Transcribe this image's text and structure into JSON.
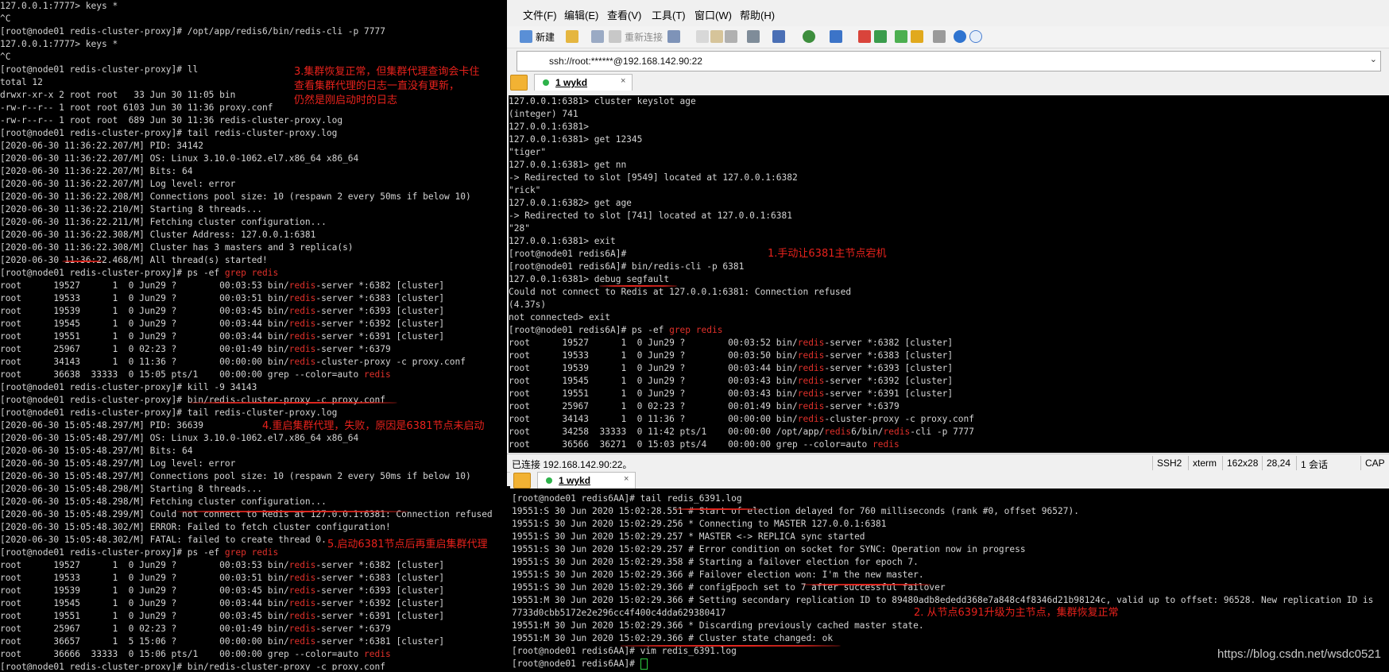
{
  "left_terminal": {
    "lines": [
      "127.0.0.1:7777> keys *",
      "^C",
      "[root@node01 redis-cluster-proxy]# /opt/app/redis6/bin/redis-cli -p 7777",
      "127.0.0.1:7777> keys *",
      "^C",
      "[root@node01 redis-cluster-proxy]# ll",
      "total 12",
      "drwxr-xr-x 2 root root   33 Jun 30 11:05 bin",
      "-rw-r--r-- 1 root root 6103 Jun 30 11:36 proxy.conf",
      "-rw-r--r-- 1 root root  689 Jun 30 11:36 redis-cluster-proxy.log",
      "[root@node01 redis-cluster-proxy]# tail redis-cluster-proxy.log",
      "[2020-06-30 11:36:22.207/M] PID: 34142",
      "[2020-06-30 11:36:22.207/M] OS: Linux 3.10.0-1062.el7.x86_64 x86_64",
      "[2020-06-30 11:36:22.207/M] Bits: 64",
      "[2020-06-30 11:36:22.207/M] Log level: error",
      "[2020-06-30 11:36:22.208/M] Connections pool size: 10 (respawn 2 every 50ms if below 10)",
      "[2020-06-30 11:36:22.210/M] Starting 8 threads...",
      "[2020-06-30 11:36:22.211/M] Fetching cluster configuration...",
      "[2020-06-30 11:36:22.308/M] Cluster Address: 127.0.0.1:6381",
      "[2020-06-30 11:36:22.308/M] Cluster has 3 masters and 3 replica(s)",
      "[2020-06-30 11:36:22.468/M] All thread(s) started!",
      "[root@node01 redis-cluster-proxy]# ps -ef |grep redis",
      "root      19527      1  0 Jun29 ?        00:03:53 bin/|redis|-server *:6382 [cluster]",
      "root      19533      1  0 Jun29 ?        00:03:51 bin/|redis|-server *:6383 [cluster]",
      "root      19539      1  0 Jun29 ?        00:03:45 bin/|redis|-server *:6393 [cluster]",
      "root      19545      1  0 Jun29 ?        00:03:44 bin/|redis|-server *:6392 [cluster]",
      "root      19551      1  0 Jun29 ?        00:03:44 bin/|redis|-server *:6391 [cluster]",
      "root      25967      1  0 02:23 ?        00:01:49 bin/|redis|-server *:6379",
      "root      34143      1  0 11:36 ?        00:00:00 bin/|redis|-cluster-proxy -c proxy.conf",
      "root      36638  33333  0 15:05 pts/1    00:00:00 grep --color=auto |redis|",
      "[root@node01 redis-cluster-proxy]# kill -9 34143",
      "[root@node01 redis-cluster-proxy]# bin/redis-cluster-proxy -c proxy.conf",
      "[root@node01 redis-cluster-proxy]# tail redis-cluster-proxy.log",
      "[2020-06-30 15:05:48.297/M] PID: 36639",
      "[2020-06-30 15:05:48.297/M] OS: Linux 3.10.0-1062.el7.x86_64 x86_64",
      "[2020-06-30 15:05:48.297/M] Bits: 64",
      "[2020-06-30 15:05:48.297/M] Log level: error",
      "[2020-06-30 15:05:48.297/M] Connections pool size: 10 (respawn 2 every 50ms if below 10)",
      "[2020-06-30 15:05:48.298/M] Starting 8 threads...",
      "[2020-06-30 15:05:48.298/M] Fetching cluster configuration...",
      "[2020-06-30 15:05:48.299/M] Could not connect to Redis at 127.0.0.1:6381: Connection refused",
      "[2020-06-30 15:05:48.302/M] ERROR: Failed to fetch cluster configuration!",
      "[2020-06-30 15:05:48.302/M] FATAL: failed to create thread 0.",
      "[root@node01 redis-cluster-proxy]# ps -ef |grep redis",
      "root      19527      1  0 Jun29 ?        00:03:53 bin/|redis|-server *:6382 [cluster]",
      "root      19533      1  0 Jun29 ?        00:03:51 bin/|redis|-server *:6383 [cluster]",
      "root      19539      1  0 Jun29 ?        00:03:45 bin/|redis|-server *:6393 [cluster]",
      "root      19545      1  0 Jun29 ?        00:03:44 bin/|redis|-server *:6392 [cluster]",
      "root      19551      1  0 Jun29 ?        00:03:45 bin/|redis|-server *:6391 [cluster]",
      "root      25967      1  0 02:23 ?        00:01:49 bin/|redis|-server *:6379",
      "root      36657      1  5 15:06 ?        00:00:00 bin/|redis|-server *:6381 [cluster]",
      "root      36666  33333  0 15:06 pts/1    00:00:00 grep --color=auto |redis|",
      "[root@node01 redis-cluster-proxy]# bin/redis-cluster-proxy -c proxy.conf"
    ]
  },
  "annotations": {
    "a3": "3.集群恢复正常，但集群代理查询会卡住\n查看集群代理的日志一直没有更新，\n仍然是刚启动时的日志",
    "a4": "4.重启集群代理，失败，原因是6381节点未启动",
    "a5": "5.启动6381节点后再重启集群代理",
    "a1": "1.手动让6381主节点宕机",
    "a2": "2. 从节点6391升级为主节点，集群恢复正常"
  },
  "menu": [
    "文件(F)",
    "编辑(E)",
    "查看(V)",
    "工具(T)",
    "窗口(W)",
    "帮助(H)"
  ],
  "toolbar": {
    "new_label": "新建",
    "reconnect_label": "重新连接"
  },
  "address": "ssh://root:******@192.168.142.90:22",
  "tab_top": {
    "label": "1 wykd",
    "close": "×"
  },
  "tab_bottom": {
    "label": "1 wykd",
    "close": "×"
  },
  "top_terminal": {
    "lines": [
      "127.0.0.1:6381> cluster keyslot age",
      "(integer) 741",
      "127.0.0.1:6381>",
      "127.0.0.1:6381> get 12345",
      "\"tiger\"",
      "127.0.0.1:6381> get nn",
      "-> Redirected to slot [9549] located at 127.0.0.1:6382",
      "\"rick\"",
      "127.0.0.1:6382> get age",
      "-> Redirected to slot [741] located at 127.0.0.1:6381",
      "\"28\"",
      "127.0.0.1:6381> exit",
      "[root@node01 redis6A]#",
      "[root@node01 redis6A]# bin/redis-cli -p 6381",
      "127.0.0.1:6381> debug segfault",
      "Could not connect to Redis at 127.0.0.1:6381: Connection refused",
      "(4.37s)",
      "not connected> exit",
      "[root@node01 redis6A]# ps -ef |grep redis",
      "root      19527      1  0 Jun29 ?        00:03:52 bin/|redis|-server *:6382 [cluster]",
      "root      19533      1  0 Jun29 ?        00:03:50 bin/|redis|-server *:6383 [cluster]",
      "root      19539      1  0 Jun29 ?        00:03:44 bin/|redis|-server *:6393 [cluster]",
      "root      19545      1  0 Jun29 ?        00:03:43 bin/|redis|-server *:6392 [cluster]",
      "root      19551      1  0 Jun29 ?        00:03:43 bin/|redis|-server *:6391 [cluster]",
      "root      25967      1  0 02:23 ?        00:01:49 bin/|redis|-server *:6379",
      "root      34143      1  0 11:36 ?        00:00:00 bin/|redis|-cluster-proxy -c proxy.conf",
      "root      34258  33333  0 11:42 pts/1    00:00:00 /opt/app/|redis|6/bin/|redis|-cli -p 7777",
      "root      36566  36271  0 15:03 pts/4    00:00:00 grep --color=auto |redis|"
    ]
  },
  "status": {
    "connected": "已连接 192.168.142.90:22。",
    "proto": "SSH2",
    "term": "xterm",
    "size": "162x28",
    "pos": "28,24",
    "sessions": "1 会话",
    "caps": "CAP"
  },
  "bottom_terminal": {
    "lines": [
      "[root@node01 redis6AA]# tail redis_6391.log",
      "19551:S 30 Jun 2020 15:02:28.551 # Start of election delayed for 760 milliseconds (rank #0, offset 96527).",
      "19551:S 30 Jun 2020 15:02:29.256 * Connecting to MASTER 127.0.0.1:6381",
      "19551:S 30 Jun 2020 15:02:29.257 * MASTER <-> REPLICA sync started",
      "19551:S 30 Jun 2020 15:02:29.257 # Error condition on socket for SYNC: Operation now in progress",
      "19551:S 30 Jun 2020 15:02:29.358 # Starting a failover election for epoch 7.",
      "19551:S 30 Jun 2020 15:02:29.366 # Failover election won: I'm the new master.",
      "19551:S 30 Jun 2020 15:02:29.366 # configEpoch set to 7 after successful failover",
      "19551:M 30 Jun 2020 15:02:29.366 # Setting secondary replication ID to 89480adb8ededd368e7a848c4f8346d21b98124c, valid up to offset: 96528. New replication ID is",
      "7733d0cbb5172e2e296cc4f400c4dda629380417",
      "19551:M 30 Jun 2020 15:02:29.366 * Discarding previously cached master state.",
      "19551:M 30 Jun 2020 15:02:29.366 # Cluster state changed: ok",
      "[root@node01 redis6AA]# vim redis_6391.log",
      "[root@node01 redis6AA]# "
    ]
  },
  "watermark": "https://blog.csdn.net/wsdc0521",
  "colors": {
    "highlight": "#e0302a",
    "annotation": "#e8221c",
    "cursor": "#2ecc40"
  }
}
